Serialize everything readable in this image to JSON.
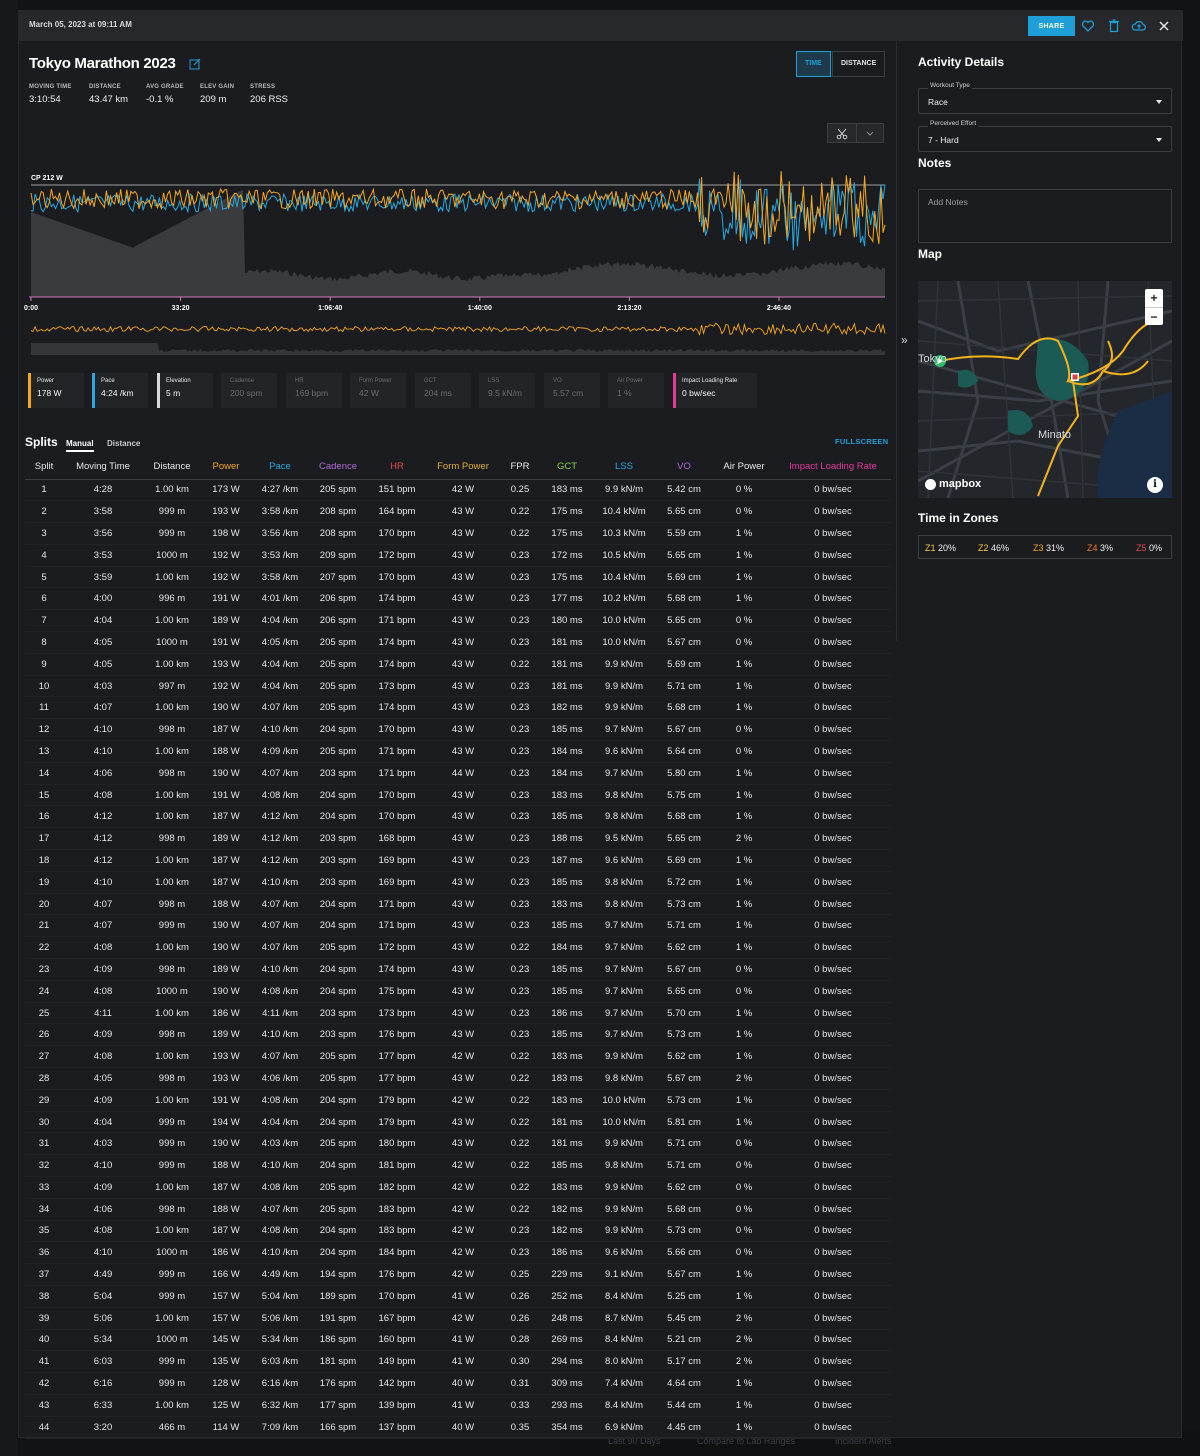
{
  "header": {
    "date": "March 05, 2023 at 09:11 AM",
    "share_label": "SHARE",
    "icons": [
      "heart-icon",
      "trash-icon",
      "cloud-upload-icon",
      "close-icon"
    ]
  },
  "activity": {
    "title": "Tokyo Marathon 2023",
    "view_toggle": [
      "TIME",
      "DISTANCE"
    ],
    "active_view": "TIME",
    "stats": [
      {
        "label": "MOVING TIME",
        "value": "3:10:54"
      },
      {
        "label": "DISTANCE",
        "value": "43.47 km"
      },
      {
        "label": "AVG GRADE",
        "value": "-0.1 %"
      },
      {
        "label": "ELEV GAIN",
        "value": "209 m"
      },
      {
        "label": "STRESS",
        "value": "206 RSS"
      }
    ]
  },
  "chart_data": {
    "type": "line",
    "cp_label": "CP 212 W",
    "x_ticks": [
      "0:00",
      "33:20",
      "1:06:40",
      "1:40:00",
      "2:13:20",
      "2:46:40"
    ],
    "series": [
      {
        "name": "Power",
        "color": "#f5a623"
      },
      {
        "name": "Pace",
        "color": "#27a8e0"
      },
      {
        "name": "Elevation",
        "color": "#3a3b3e"
      }
    ]
  },
  "metrics": [
    {
      "label": "Power",
      "value": "178 W",
      "color": "#f5a623",
      "active": true
    },
    {
      "label": "Pace",
      "value": "4:24 /km",
      "color": "#27a8e0",
      "active": true
    },
    {
      "label": "Elevation",
      "value": "5 m",
      "color": "#d7d9dc",
      "active": true
    },
    {
      "label": "Cadence",
      "value": "200 spm",
      "color": "",
      "active": false
    },
    {
      "label": "HR",
      "value": "169 bpm",
      "color": "",
      "active": false
    },
    {
      "label": "Form Power",
      "value": "42 W",
      "color": "",
      "active": false
    },
    {
      "label": "GCT",
      "value": "204 ms",
      "color": "",
      "active": false
    },
    {
      "label": "LSS",
      "value": "9.5 kN/m",
      "color": "",
      "active": false
    },
    {
      "label": "VO",
      "value": "5.57 cm",
      "color": "",
      "active": false
    },
    {
      "label": "Air Power",
      "value": "1 %",
      "color": "",
      "active": false
    },
    {
      "label": "Impact Loading Rate",
      "value": "0 bw/sec",
      "color": "#e43aa0",
      "active": true
    }
  ],
  "splits": {
    "title": "Splits",
    "tabs": [
      "Manual",
      "Distance"
    ],
    "fullscreen_label": "FULLSCREEN",
    "columns": [
      {
        "label": "Split",
        "color": "#e6e7e9"
      },
      {
        "label": "Moving Time",
        "color": "#e6e7e9"
      },
      {
        "label": "Distance",
        "color": "#e6e7e9"
      },
      {
        "label": "Power",
        "color": "#f5a623"
      },
      {
        "label": "Pace",
        "color": "#27a8e0"
      },
      {
        "label": "Cadence",
        "color": "#b06ad6"
      },
      {
        "label": "HR",
        "color": "#e04a4a"
      },
      {
        "label": "Form Power",
        "color": "#e0b03a"
      },
      {
        "label": "FPR",
        "color": "#e6e7e9"
      },
      {
        "label": "GCT",
        "color": "#8bd14a"
      },
      {
        "label": "LSS",
        "color": "#27a8e0"
      },
      {
        "label": "VO",
        "color": "#b06ad6"
      },
      {
        "label": "Air Power",
        "color": "#e6e7e9"
      },
      {
        "label": "Impact Loading Rate",
        "color": "#e43aa0"
      }
    ],
    "rows": [
      [
        "1",
        "4:28",
        "1.00 km",
        "173 W",
        "4:27 /km",
        "205 spm",
        "151 bpm",
        "42 W",
        "0.25",
        "183 ms",
        "9.9 kN/m",
        "5.42 cm",
        "0 %",
        "0 bw/sec"
      ],
      [
        "2",
        "3:58",
        "999 m",
        "193 W",
        "3:58 /km",
        "208 spm",
        "164 bpm",
        "43 W",
        "0.22",
        "175 ms",
        "10.4 kN/m",
        "5.65 cm",
        "0 %",
        "0 bw/sec"
      ],
      [
        "3",
        "3:56",
        "999 m",
        "198 W",
        "3:56 /km",
        "208 spm",
        "170 bpm",
        "43 W",
        "0.22",
        "175 ms",
        "10.3 kN/m",
        "5.59 cm",
        "1 %",
        "0 bw/sec"
      ],
      [
        "4",
        "3:53",
        "1000 m",
        "192 W",
        "3:53 /km",
        "209 spm",
        "172 bpm",
        "43 W",
        "0.23",
        "172 ms",
        "10.5 kN/m",
        "5.65 cm",
        "1 %",
        "0 bw/sec"
      ],
      [
        "5",
        "3:59",
        "1.00 km",
        "192 W",
        "3:58 /km",
        "207 spm",
        "170 bpm",
        "43 W",
        "0.23",
        "175 ms",
        "10.4 kN/m",
        "5.69 cm",
        "1 %",
        "0 bw/sec"
      ],
      [
        "6",
        "4:00",
        "996 m",
        "191 W",
        "4:01 /km",
        "206 spm",
        "174 bpm",
        "43 W",
        "0.23",
        "177 ms",
        "10.2 kN/m",
        "5.68 cm",
        "1 %",
        "0 bw/sec"
      ],
      [
        "7",
        "4:04",
        "1.00 km",
        "189 W",
        "4:04 /km",
        "206 spm",
        "171 bpm",
        "43 W",
        "0.23",
        "180 ms",
        "10.0 kN/m",
        "5.65 cm",
        "0 %",
        "0 bw/sec"
      ],
      [
        "8",
        "4:05",
        "1000 m",
        "191 W",
        "4:05 /km",
        "205 spm",
        "174 bpm",
        "43 W",
        "0.23",
        "181 ms",
        "10.0 kN/m",
        "5.67 cm",
        "0 %",
        "0 bw/sec"
      ],
      [
        "9",
        "4:05",
        "1.00 km",
        "193 W",
        "4:04 /km",
        "205 spm",
        "174 bpm",
        "43 W",
        "0.22",
        "181 ms",
        "9.9 kN/m",
        "5.69 cm",
        "1 %",
        "0 bw/sec"
      ],
      [
        "10",
        "4:03",
        "997 m",
        "192 W",
        "4:04 /km",
        "205 spm",
        "173 bpm",
        "43 W",
        "0.23",
        "181 ms",
        "9.9 kN/m",
        "5.71 cm",
        "1 %",
        "0 bw/sec"
      ],
      [
        "11",
        "4:07",
        "1.00 km",
        "190 W",
        "4:07 /km",
        "205 spm",
        "174 bpm",
        "43 W",
        "0.23",
        "182 ms",
        "9.9 kN/m",
        "5.68 cm",
        "1 %",
        "0 bw/sec"
      ],
      [
        "12",
        "4:10",
        "998 m",
        "187 W",
        "4:10 /km",
        "204 spm",
        "170 bpm",
        "43 W",
        "0.23",
        "185 ms",
        "9.7 kN/m",
        "5.67 cm",
        "0 %",
        "0 bw/sec"
      ],
      [
        "13",
        "4:10",
        "1.00 km",
        "188 W",
        "4:09 /km",
        "205 spm",
        "171 bpm",
        "43 W",
        "0.23",
        "184 ms",
        "9.6 kN/m",
        "5.64 cm",
        "0 %",
        "0 bw/sec"
      ],
      [
        "14",
        "4:06",
        "998 m",
        "190 W",
        "4:07 /km",
        "203 spm",
        "171 bpm",
        "44 W",
        "0.23",
        "184 ms",
        "9.7 kN/m",
        "5.80 cm",
        "1 %",
        "0 bw/sec"
      ],
      [
        "15",
        "4:08",
        "1.00 km",
        "191 W",
        "4:08 /km",
        "204 spm",
        "170 bpm",
        "43 W",
        "0.23",
        "183 ms",
        "9.8 kN/m",
        "5.75 cm",
        "1 %",
        "0 bw/sec"
      ],
      [
        "16",
        "4:12",
        "1.00 km",
        "187 W",
        "4:12 /km",
        "204 spm",
        "170 bpm",
        "43 W",
        "0.23",
        "185 ms",
        "9.8 kN/m",
        "5.68 cm",
        "1 %",
        "0 bw/sec"
      ],
      [
        "17",
        "4:12",
        "998 m",
        "189 W",
        "4:12 /km",
        "203 spm",
        "168 bpm",
        "43 W",
        "0.23",
        "188 ms",
        "9.5 kN/m",
        "5.65 cm",
        "2 %",
        "0 bw/sec"
      ],
      [
        "18",
        "4:12",
        "1.00 km",
        "187 W",
        "4:12 /km",
        "203 spm",
        "169 bpm",
        "43 W",
        "0.23",
        "187 ms",
        "9.6 kN/m",
        "5.69 cm",
        "1 %",
        "0 bw/sec"
      ],
      [
        "19",
        "4:10",
        "1.00 km",
        "187 W",
        "4:10 /km",
        "203 spm",
        "169 bpm",
        "43 W",
        "0.23",
        "185 ms",
        "9.8 kN/m",
        "5.72 cm",
        "1 %",
        "0 bw/sec"
      ],
      [
        "20",
        "4:07",
        "998 m",
        "188 W",
        "4:07 /km",
        "204 spm",
        "171 bpm",
        "43 W",
        "0.23",
        "183 ms",
        "9.8 kN/m",
        "5.73 cm",
        "1 %",
        "0 bw/sec"
      ],
      [
        "21",
        "4:07",
        "999 m",
        "190 W",
        "4:07 /km",
        "204 spm",
        "171 bpm",
        "43 W",
        "0.23",
        "185 ms",
        "9.7 kN/m",
        "5.71 cm",
        "1 %",
        "0 bw/sec"
      ],
      [
        "22",
        "4:08",
        "1.00 km",
        "190 W",
        "4:07 /km",
        "205 spm",
        "172 bpm",
        "43 W",
        "0.22",
        "184 ms",
        "9.7 kN/m",
        "5.62 cm",
        "1 %",
        "0 bw/sec"
      ],
      [
        "23",
        "4:09",
        "998 m",
        "189 W",
        "4:10 /km",
        "204 spm",
        "174 bpm",
        "43 W",
        "0.23",
        "185 ms",
        "9.7 kN/m",
        "5.67 cm",
        "0 %",
        "0 bw/sec"
      ],
      [
        "24",
        "4:08",
        "1000 m",
        "190 W",
        "4:08 /km",
        "204 spm",
        "175 bpm",
        "43 W",
        "0.23",
        "185 ms",
        "9.7 kN/m",
        "5.65 cm",
        "0 %",
        "0 bw/sec"
      ],
      [
        "25",
        "4:11",
        "1.00 km",
        "186 W",
        "4:11 /km",
        "203 spm",
        "173 bpm",
        "43 W",
        "0.23",
        "186 ms",
        "9.7 kN/m",
        "5.70 cm",
        "1 %",
        "0 bw/sec"
      ],
      [
        "26",
        "4:09",
        "998 m",
        "189 W",
        "4:10 /km",
        "203 spm",
        "176 bpm",
        "43 W",
        "0.23",
        "185 ms",
        "9.7 kN/m",
        "5.73 cm",
        "1 %",
        "0 bw/sec"
      ],
      [
        "27",
        "4:08",
        "1.00 km",
        "193 W",
        "4:07 /km",
        "205 spm",
        "177 bpm",
        "42 W",
        "0.22",
        "183 ms",
        "9.9 kN/m",
        "5.62 cm",
        "1 %",
        "0 bw/sec"
      ],
      [
        "28",
        "4:05",
        "998 m",
        "193 W",
        "4:06 /km",
        "205 spm",
        "177 bpm",
        "43 W",
        "0.22",
        "183 ms",
        "9.8 kN/m",
        "5.67 cm",
        "2 %",
        "0 bw/sec"
      ],
      [
        "29",
        "4:09",
        "1.00 km",
        "191 W",
        "4:08 /km",
        "204 spm",
        "179 bpm",
        "42 W",
        "0.22",
        "183 ms",
        "10.0 kN/m",
        "5.73 cm",
        "1 %",
        "0 bw/sec"
      ],
      [
        "30",
        "4:04",
        "999 m",
        "194 W",
        "4:04 /km",
        "204 spm",
        "179 bpm",
        "43 W",
        "0.22",
        "181 ms",
        "10.0 kN/m",
        "5.81 cm",
        "1 %",
        "0 bw/sec"
      ],
      [
        "31",
        "4:03",
        "999 m",
        "190 W",
        "4:03 /km",
        "205 spm",
        "180 bpm",
        "43 W",
        "0.22",
        "181 ms",
        "9.9 kN/m",
        "5.71 cm",
        "0 %",
        "0 bw/sec"
      ],
      [
        "32",
        "4:10",
        "999 m",
        "188 W",
        "4:10 /km",
        "204 spm",
        "181 bpm",
        "42 W",
        "0.22",
        "185 ms",
        "9.8 kN/m",
        "5.71 cm",
        "0 %",
        "0 bw/sec"
      ],
      [
        "33",
        "4:09",
        "1.00 km",
        "187 W",
        "4:08 /km",
        "205 spm",
        "182 bpm",
        "42 W",
        "0.22",
        "183 ms",
        "9.9 kN/m",
        "5.62 cm",
        "0 %",
        "0 bw/sec"
      ],
      [
        "34",
        "4:06",
        "998 m",
        "188 W",
        "4:07 /km",
        "205 spm",
        "183 bpm",
        "42 W",
        "0.22",
        "182 ms",
        "9.9 kN/m",
        "5.68 cm",
        "0 %",
        "0 bw/sec"
      ],
      [
        "35",
        "4:08",
        "1.00 km",
        "187 W",
        "4:08 /km",
        "204 spm",
        "183 bpm",
        "42 W",
        "0.23",
        "182 ms",
        "9.9 kN/m",
        "5.73 cm",
        "0 %",
        "0 bw/sec"
      ],
      [
        "36",
        "4:10",
        "1000 m",
        "186 W",
        "4:10 /km",
        "204 spm",
        "184 bpm",
        "42 W",
        "0.23",
        "186 ms",
        "9.6 kN/m",
        "5.66 cm",
        "0 %",
        "0 bw/sec"
      ],
      [
        "37",
        "4:49",
        "999 m",
        "166 W",
        "4:49 /km",
        "194 spm",
        "176 bpm",
        "42 W",
        "0.25",
        "229 ms",
        "9.1 kN/m",
        "5.67 cm",
        "1 %",
        "0 bw/sec"
      ],
      [
        "38",
        "5:04",
        "999 m",
        "157 W",
        "5:04 /km",
        "189 spm",
        "170 bpm",
        "41 W",
        "0.26",
        "252 ms",
        "8.4 kN/m",
        "5.25 cm",
        "1 %",
        "0 bw/sec"
      ],
      [
        "39",
        "5:06",
        "1.00 km",
        "157 W",
        "5:06 /km",
        "191 spm",
        "167 bpm",
        "42 W",
        "0.26",
        "248 ms",
        "8.7 kN/m",
        "5.45 cm",
        "2 %",
        "0 bw/sec"
      ],
      [
        "40",
        "5:34",
        "1000 m",
        "145 W",
        "5:34 /km",
        "186 spm",
        "160 bpm",
        "41 W",
        "0.28",
        "269 ms",
        "8.4 kN/m",
        "5.21 cm",
        "2 %",
        "0 bw/sec"
      ],
      [
        "41",
        "6:03",
        "999 m",
        "135 W",
        "6:03 /km",
        "181 spm",
        "149 bpm",
        "41 W",
        "0.30",
        "294 ms",
        "8.0 kN/m",
        "5.17 cm",
        "2 %",
        "0 bw/sec"
      ],
      [
        "42",
        "6:16",
        "999 m",
        "128 W",
        "6:16 /km",
        "176 spm",
        "142 bpm",
        "40 W",
        "0.31",
        "309 ms",
        "7.4 kN/m",
        "4.64 cm",
        "1 %",
        "0 bw/sec"
      ],
      [
        "43",
        "6:33",
        "1.00 km",
        "125 W",
        "6:32 /km",
        "177 spm",
        "139 bpm",
        "41 W",
        "0.33",
        "293 ms",
        "8.4 kN/m",
        "5.44 cm",
        "1 %",
        "0 bw/sec"
      ],
      [
        "44",
        "3:20",
        "466 m",
        "114 W",
        "7:09 /km",
        "166 spm",
        "137 bpm",
        "40 W",
        "0.35",
        "354 ms",
        "6.9 kN/m",
        "4.45 cm",
        "1 %",
        "0 bw/sec"
      ]
    ]
  },
  "details": {
    "title": "Activity Details",
    "workout_type_label": "Workout Type",
    "workout_type_value": "Race",
    "effort_label": "Perceived Effort",
    "effort_value": "7 - Hard",
    "notes_title": "Notes",
    "notes_placeholder": "Add Notes",
    "map_title": "Map",
    "map_labels": {
      "city": "Tokyo",
      "district": "Minato",
      "brand": "mapbox"
    },
    "zoom_in": "+",
    "zoom_out": "−",
    "zones_title": "Time in Zones",
    "zones": [
      {
        "label": "Z1",
        "value": "20%",
        "color": "#f5c842"
      },
      {
        "label": "Z2",
        "value": "46%",
        "color": "#f5c842"
      },
      {
        "label": "Z3",
        "value": "31%",
        "color": "#f5a623"
      },
      {
        "label": "Z4",
        "value": "3%",
        "color": "#f07a2a"
      },
      {
        "label": "Z5",
        "value": "0%",
        "color": "#e04a4a"
      }
    ]
  },
  "background": {
    "footer_items": [
      "Last 90 Days",
      "Compare to Lab Ranges",
      "Incident Alerts"
    ]
  }
}
